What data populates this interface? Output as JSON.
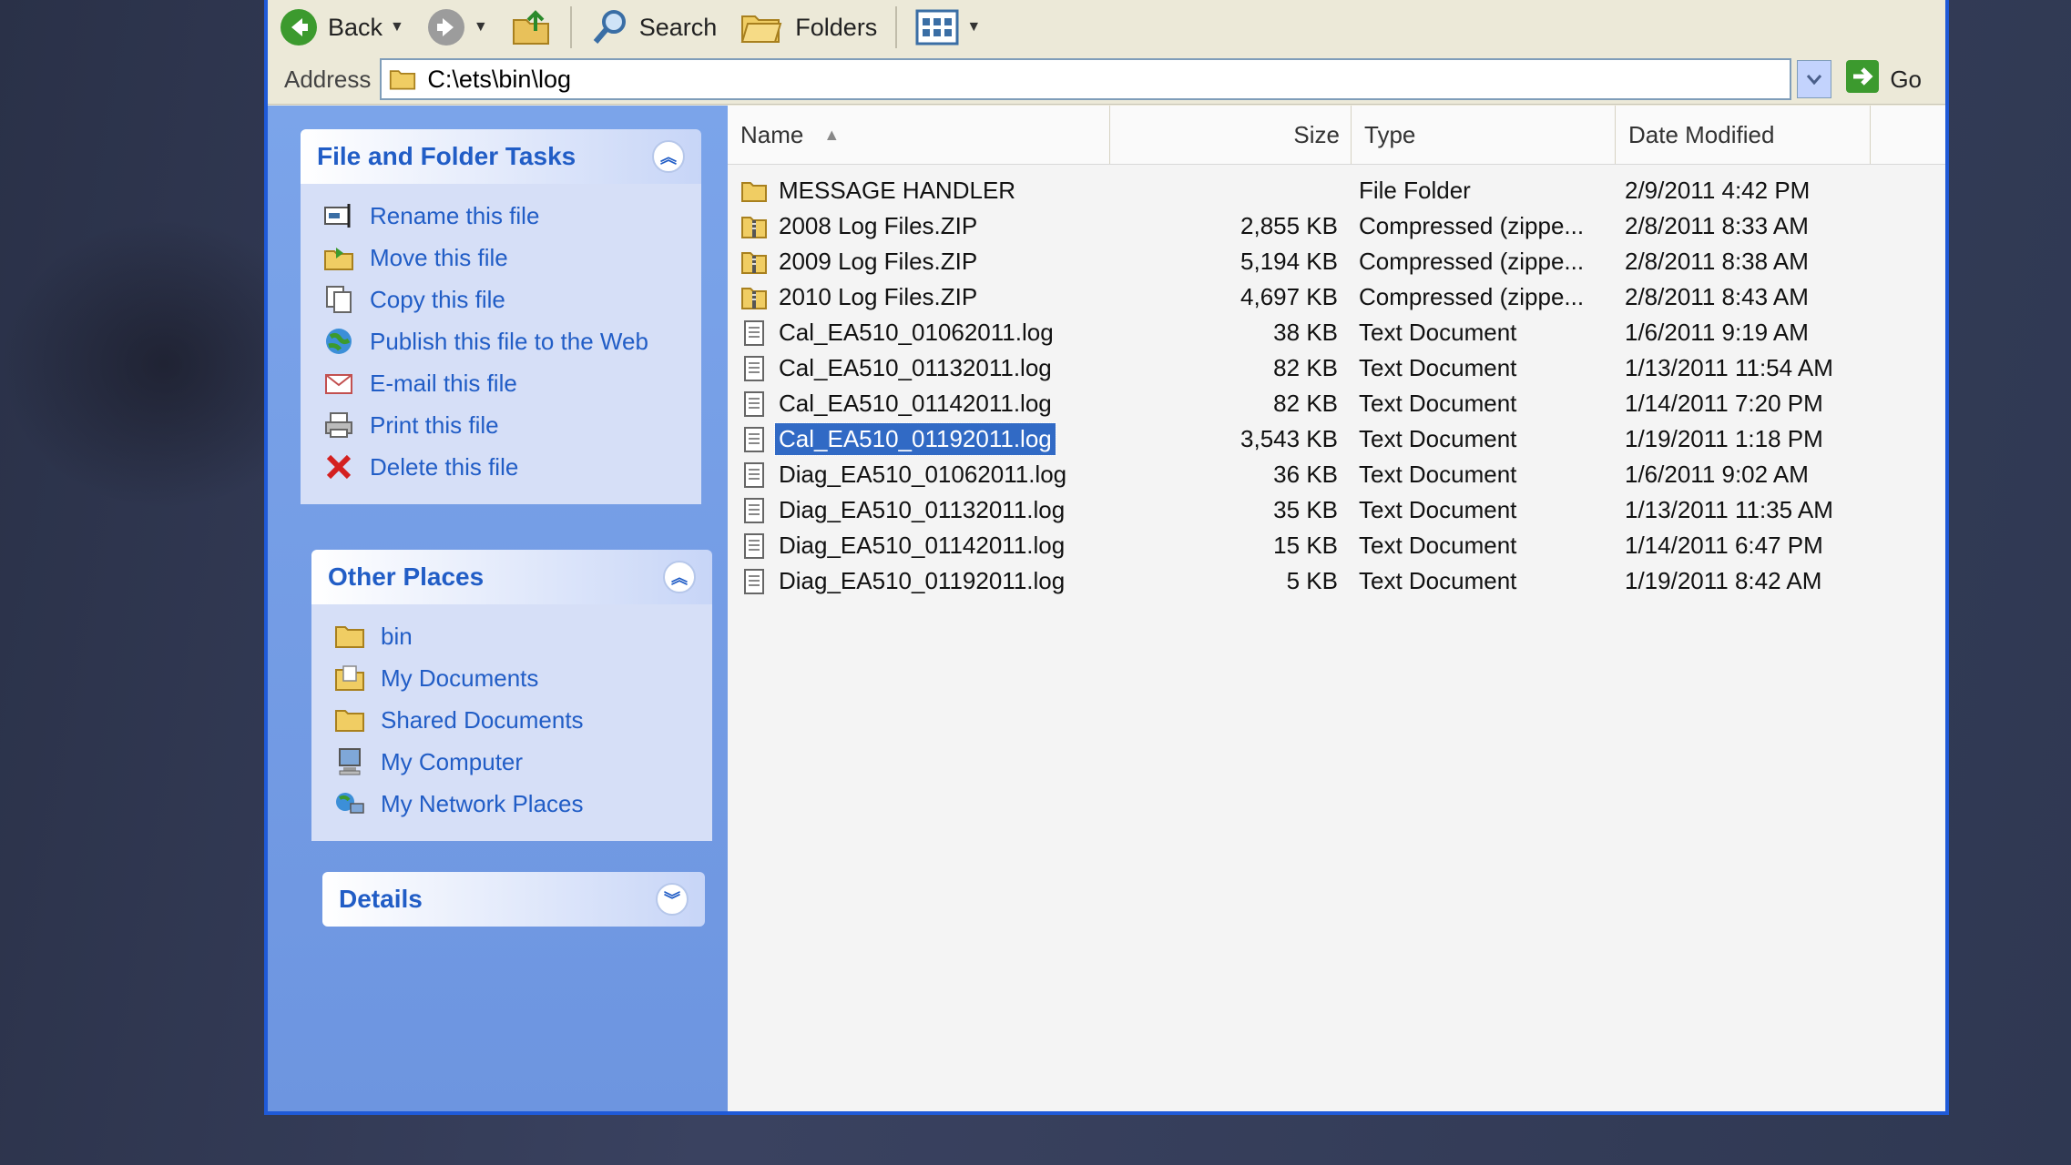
{
  "toolbar": {
    "back_label": "Back",
    "search_label": "Search",
    "folders_label": "Folders"
  },
  "address": {
    "label": "Address",
    "path": "C:\\ets\\bin\\log",
    "go_label": "Go"
  },
  "file_tasks": {
    "title": "File and Folder Tasks",
    "items": [
      {
        "label": "Rename this file",
        "icon": "rename-icon"
      },
      {
        "label": "Move this file",
        "icon": "move-icon"
      },
      {
        "label": "Copy this file",
        "icon": "copy-icon"
      },
      {
        "label": "Publish this file to the Web",
        "icon": "globe-icon"
      },
      {
        "label": "E-mail this file",
        "icon": "email-icon"
      },
      {
        "label": "Print this file",
        "icon": "printer-icon"
      },
      {
        "label": "Delete this file",
        "icon": "delete-icon"
      }
    ]
  },
  "other_places": {
    "title": "Other Places",
    "items": [
      {
        "label": "bin",
        "icon": "folder-icon"
      },
      {
        "label": "My Documents",
        "icon": "my-documents-icon"
      },
      {
        "label": "Shared Documents",
        "icon": "folder-icon"
      },
      {
        "label": "My Computer",
        "icon": "computer-icon"
      },
      {
        "label": "My Network Places",
        "icon": "network-icon"
      }
    ]
  },
  "details": {
    "title": "Details"
  },
  "columns": {
    "name": "Name",
    "size": "Size",
    "type": "Type",
    "date": "Date Modified"
  },
  "files": [
    {
      "name": "MESSAGE HANDLER",
      "size": "",
      "type": "File Folder",
      "date": "2/9/2011 4:42 PM",
      "icon": "folder-icon"
    },
    {
      "name": "2008 Log Files.ZIP",
      "size": "2,855 KB",
      "type": "Compressed (zippe...",
      "date": "2/8/2011 8:33 AM",
      "icon": "zip-folder-icon"
    },
    {
      "name": "2009 Log Files.ZIP",
      "size": "5,194 KB",
      "type": "Compressed (zippe...",
      "date": "2/8/2011 8:38 AM",
      "icon": "zip-folder-icon"
    },
    {
      "name": "2010 Log Files.ZIP",
      "size": "4,697 KB",
      "type": "Compressed (zippe...",
      "date": "2/8/2011 8:43 AM",
      "icon": "zip-folder-icon"
    },
    {
      "name": "Cal_EA510_01062011.log",
      "size": "38 KB",
      "type": "Text Document",
      "date": "1/6/2011 9:19 AM",
      "icon": "text-document-icon"
    },
    {
      "name": "Cal_EA510_01132011.log",
      "size": "82 KB",
      "type": "Text Document",
      "date": "1/13/2011 11:54 AM",
      "icon": "text-document-icon"
    },
    {
      "name": "Cal_EA510_01142011.log",
      "size": "82 KB",
      "type": "Text Document",
      "date": "1/14/2011 7:20 PM",
      "icon": "text-document-icon"
    },
    {
      "name": "Cal_EA510_01192011.log",
      "size": "3,543 KB",
      "type": "Text Document",
      "date": "1/19/2011 1:18 PM",
      "icon": "text-document-icon",
      "selected": true
    },
    {
      "name": "Diag_EA510_01062011.log",
      "size": "36 KB",
      "type": "Text Document",
      "date": "1/6/2011 9:02 AM",
      "icon": "text-document-icon"
    },
    {
      "name": "Diag_EA510_01132011.log",
      "size": "35 KB",
      "type": "Text Document",
      "date": "1/13/2011 11:35 AM",
      "icon": "text-document-icon"
    },
    {
      "name": "Diag_EA510_01142011.log",
      "size": "15 KB",
      "type": "Text Document",
      "date": "1/14/2011 6:47 PM",
      "icon": "text-document-icon"
    },
    {
      "name": "Diag_EA510_01192011.log",
      "size": "5 KB",
      "type": "Text Document",
      "date": "1/19/2011 8:42 AM",
      "icon": "text-document-icon"
    }
  ],
  "colors": {
    "selection": "#316ac5",
    "task_link": "#215dc6",
    "window_border": "#1f5ad8"
  }
}
